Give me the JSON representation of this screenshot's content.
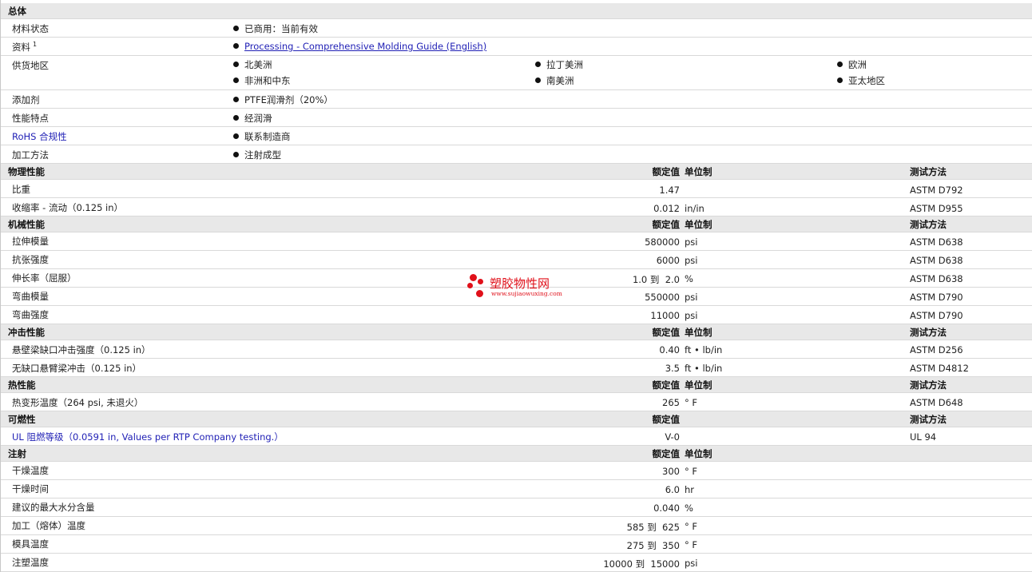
{
  "general": {
    "section_title": "总体",
    "rows": {
      "status": {
        "label": "材料状态",
        "value": "已商用：当前有效"
      },
      "docs": {
        "label": "资料",
        "sup": "1",
        "value": "Processing - Comprehensive Molding Guide (English)"
      },
      "regions": {
        "label": "供货地区",
        "items": [
          "北美洲",
          "拉丁美洲",
          "欧洲",
          "非洲和中东",
          "南美洲",
          "亚太地区"
        ]
      },
      "additive": {
        "label": "添加剂",
        "value": "PTFE润滑剂（20%）"
      },
      "features": {
        "label": "性能特点",
        "value": "经润滑"
      },
      "rohs": {
        "label": "RoHS 合规性",
        "value": "联系制造商"
      },
      "process": {
        "label": "加工方法",
        "value": "注射成型"
      }
    }
  },
  "headers": {
    "rated": "额定值",
    "unit": "单位制",
    "test": "测试方法"
  },
  "physical": {
    "title": "物理性能",
    "rows": [
      {
        "label": "比重",
        "value": "1.47",
        "unit": "",
        "test": "ASTM D792"
      },
      {
        "label": "收缩率 - 流动（0.125 in）",
        "value": "0.012",
        "unit": "in/in",
        "test": "ASTM D955"
      }
    ]
  },
  "mechanical": {
    "title": "机械性能",
    "rows": [
      {
        "label": "拉伸模量",
        "value": "580000",
        "unit": "psi",
        "test": "ASTM D638"
      },
      {
        "label": "抗张强度",
        "value": "6000",
        "unit": "psi",
        "test": "ASTM D638"
      },
      {
        "label": "伸长率（屈服）",
        "value": "1.0 到  2.0",
        "unit": "%",
        "test": "ASTM D638"
      },
      {
        "label": "弯曲模量",
        "value": "550000",
        "unit": "psi",
        "test": "ASTM D790"
      },
      {
        "label": "弯曲强度",
        "value": "11000",
        "unit": "psi",
        "test": "ASTM D790"
      }
    ]
  },
  "impact": {
    "title": "冲击性能",
    "rows": [
      {
        "label": "悬壁梁缺口冲击强度（0.125 in）",
        "value": "0.40",
        "unit": "ft • lb/in",
        "test": "ASTM D256"
      },
      {
        "label": "无缺口悬臂梁冲击（0.125 in）",
        "value": "3.5",
        "unit": "ft • lb/in",
        "test": "ASTM D4812"
      }
    ]
  },
  "thermal": {
    "title": "热性能",
    "rows": [
      {
        "label": "热变形温度（264 psi, 未退火）",
        "value": "265",
        "unit": "° F",
        "test": "ASTM D648"
      }
    ]
  },
  "flammability": {
    "title": "可燃性",
    "rows": [
      {
        "label": "UL 阻燃等级（0.0591 in, Values per RTP Company testing.）",
        "value": "V-0",
        "unit": "",
        "test": "UL 94"
      }
    ]
  },
  "injection": {
    "title": "注射",
    "rows": [
      {
        "label": "干燥温度",
        "value": "300",
        "unit": "° F",
        "test": ""
      },
      {
        "label": "干燥时间",
        "value": "6.0",
        "unit": "hr",
        "test": ""
      },
      {
        "label": "建议的最大水分含量",
        "value": "0.040",
        "unit": "%",
        "test": ""
      },
      {
        "label": "加工（熔体）温度",
        "value": "585 到  625",
        "unit": "° F",
        "test": ""
      },
      {
        "label": "模具温度",
        "value": "275 到  350",
        "unit": "° F",
        "test": ""
      },
      {
        "label": "注塑温度",
        "value": "10000 到  15000",
        "unit": "psi",
        "test": ""
      }
    ]
  },
  "watermark": {
    "title": "塑胶物性网",
    "url": "www.sujiaowuxing.com",
    "color": "#e0101a"
  }
}
